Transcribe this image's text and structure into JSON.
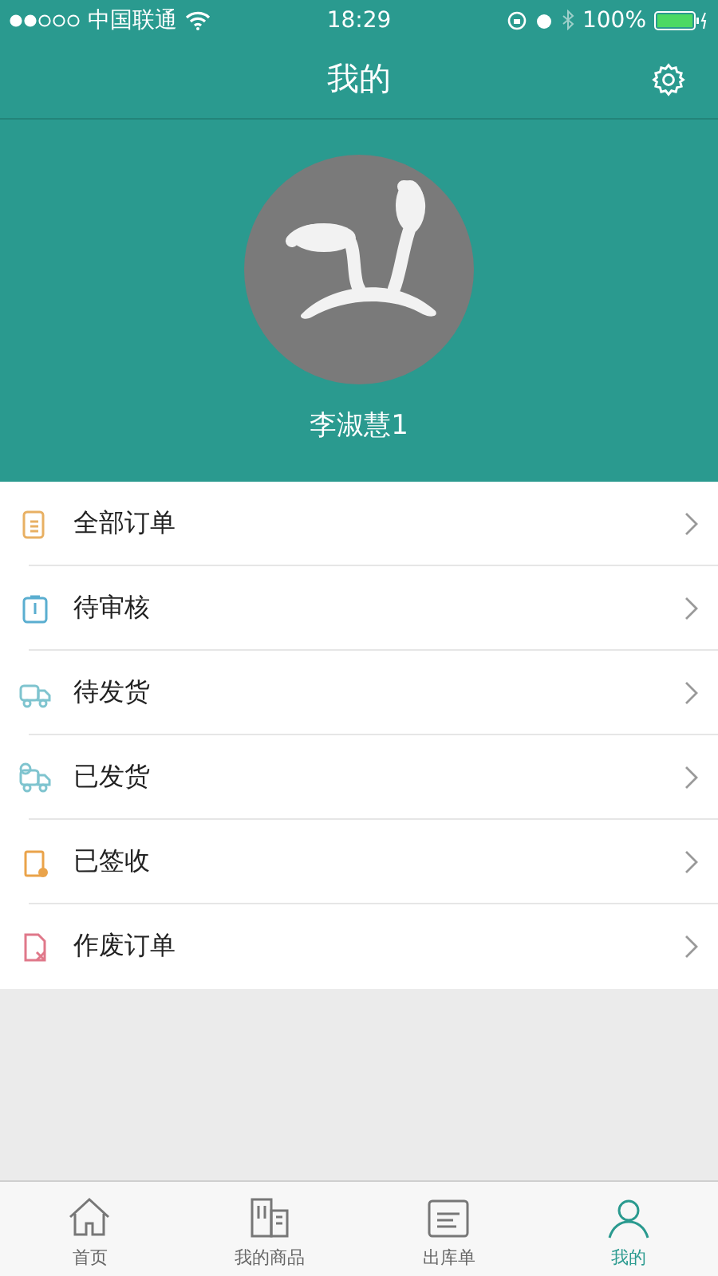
{
  "status_bar": {
    "carrier": "中国联通",
    "time": "18:29",
    "battery": "100%"
  },
  "nav": {
    "title": "我的"
  },
  "profile": {
    "name": "李淑慧1"
  },
  "menu": [
    {
      "label": "全部订单",
      "kind": "doc",
      "color": "#e8b063"
    },
    {
      "label": "待审核",
      "kind": "clipboard",
      "color": "#5aaed0"
    },
    {
      "label": "待发货",
      "kind": "truck",
      "color": "#7fc4cf"
    },
    {
      "label": "已发货",
      "kind": "truck-check",
      "color": "#7fc4cf"
    },
    {
      "label": "已签收",
      "kind": "signed",
      "color": "#eaa34a"
    },
    {
      "label": "作废订单",
      "kind": "void",
      "color": "#e0788a"
    }
  ],
  "tabs": [
    {
      "label": "首页",
      "kind": "home",
      "selected": false
    },
    {
      "label": "我的商品",
      "kind": "building",
      "selected": false
    },
    {
      "label": "出库单",
      "kind": "list",
      "selected": false
    },
    {
      "label": "我的",
      "kind": "person",
      "selected": true
    }
  ]
}
